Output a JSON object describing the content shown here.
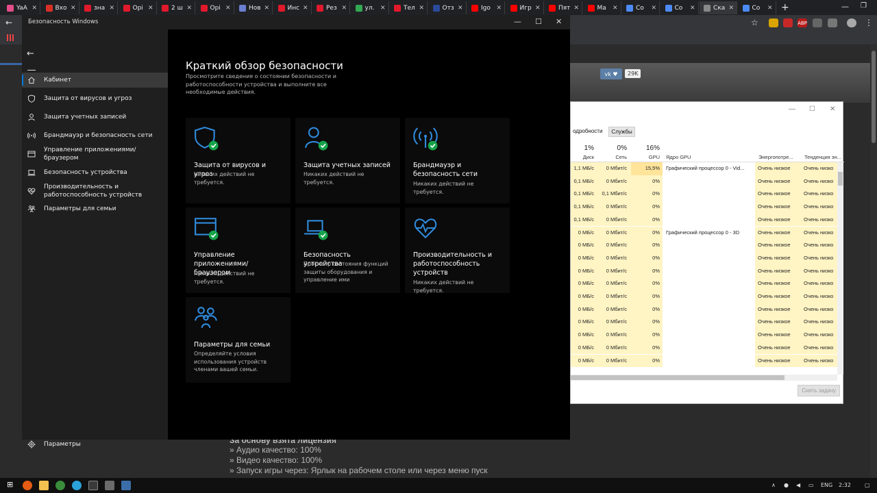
{
  "browser": {
    "tabs": [
      {
        "label": "YaA",
        "color": "#e44c8a"
      },
      {
        "label": "Вхо",
        "color": "#d93025"
      },
      {
        "label": "зна",
        "color": "#e0192b"
      },
      {
        "label": "Орі",
        "color": "#e0192b"
      },
      {
        "label": "2 ш",
        "color": "#e0192b"
      },
      {
        "label": "Орі",
        "color": "#e0192b"
      },
      {
        "label": "Нов",
        "color": "#6a7fd0"
      },
      {
        "label": "Инс",
        "color": "#e0192b"
      },
      {
        "label": "Рез",
        "color": "#e0192b"
      },
      {
        "label": "ул.",
        "color": "#34a853"
      },
      {
        "label": "Тел",
        "color": "#e0192b"
      },
      {
        "label": "Отз",
        "color": "#2b4a9a"
      },
      {
        "label": "Igo",
        "color": "#ff0000"
      },
      {
        "label": "Игр",
        "color": "#ff0000"
      },
      {
        "label": "Пят",
        "color": "#ff0000"
      },
      {
        "label": "Ма",
        "color": "#ff0000"
      },
      {
        "label": "Со",
        "color": "#4c8bf5"
      },
      {
        "label": "Со",
        "color": "#4c8bf5"
      },
      {
        "label": "Ска",
        "color": "#888888"
      },
      {
        "label": "Со",
        "color": "#4c8bf5"
      }
    ],
    "bg_page": {
      "vk_count": "29K",
      "lines": [
        "Аудио качество: 100%",
        "Видео качество: 100%",
        "Запуск игры через: Ярлык на рабочем столе или через меню пуск"
      ],
      "partial_top": "За основу взята лицензия"
    }
  },
  "task_manager": {
    "tabs": [
      "одробности",
      "Службы"
    ],
    "headers": {
      "disk_pct": "1%",
      "disk": "Диск",
      "net_pct": "0%",
      "net": "Сеть",
      "gpu_pct": "16%",
      "gpu": "GPU",
      "gpu_engine": "Ядро GPU",
      "power": "Энергопотре...",
      "power_trend": "Тенденция эн..."
    },
    "rows": [
      {
        "disk": "1,1 МБ/с",
        "net": "0 Мбит/с",
        "gpu": "15,5%",
        "engine": "Графический процессор 0 - Vid...",
        "power": "Очень низкое",
        "trend": "Очень низко"
      },
      {
        "disk": "0,1 МБ/с",
        "net": "0 Мбит/с",
        "gpu": "0%",
        "engine": "",
        "power": "Очень низкое",
        "trend": "Очень низко"
      },
      {
        "disk": "0,1 МБ/с",
        "net": "0,1 Мбит/с",
        "gpu": "0%",
        "engine": "",
        "power": "Очень низкое",
        "trend": "Очень низко"
      },
      {
        "disk": "0,1 МБ/с",
        "net": "0 Мбит/с",
        "gpu": "0%",
        "engine": "",
        "power": "Очень низкое",
        "trend": "Очень низко"
      },
      {
        "disk": "0,1 МБ/с",
        "net": "0 Мбит/с",
        "gpu": "0%",
        "engine": "",
        "power": "Очень низкое",
        "trend": "Очень низко"
      },
      {
        "disk": "0 МБ/с",
        "net": "0 Мбит/с",
        "gpu": "0%",
        "engine": "Графический процессор 0 - 3D",
        "power": "Очень низкое",
        "trend": "Очень низко"
      },
      {
        "disk": "0 МБ/с",
        "net": "0 Мбит/с",
        "gpu": "0%",
        "engine": "",
        "power": "Очень низкое",
        "trend": "Очень низко"
      },
      {
        "disk": "0 МБ/с",
        "net": "0 Мбит/с",
        "gpu": "0%",
        "engine": "",
        "power": "Очень низкое",
        "trend": "Очень низко"
      },
      {
        "disk": "0 МБ/с",
        "net": "0 Мбит/с",
        "gpu": "0%",
        "engine": "",
        "power": "Очень низкое",
        "trend": "Очень низко"
      },
      {
        "disk": "0 МБ/с",
        "net": "0 Мбит/с",
        "gpu": "0%",
        "engine": "",
        "power": "Очень низкое",
        "trend": "Очень низко"
      },
      {
        "disk": "0 МБ/с",
        "net": "0 Мбит/с",
        "gpu": "0%",
        "engine": "",
        "power": "Очень низкое",
        "trend": "Очень низко"
      },
      {
        "disk": "0 МБ/с",
        "net": "0 Мбит/с",
        "gpu": "0%",
        "engine": "",
        "power": "Очень низкое",
        "trend": "Очень низко"
      },
      {
        "disk": "0 МБ/с",
        "net": "0 Мбит/с",
        "gpu": "0%",
        "engine": "",
        "power": "Очень низкое",
        "trend": "Очень низко"
      },
      {
        "disk": "0 МБ/с",
        "net": "0 Мбит/с",
        "gpu": "0%",
        "engine": "",
        "power": "Очень низкое",
        "trend": "Очень низко"
      },
      {
        "disk": "0 МБ/с",
        "net": "0 Мбит/с",
        "gpu": "0%",
        "engine": "",
        "power": "Очень низкое",
        "trend": "Очень низко"
      },
      {
        "disk": "0 МБ/с",
        "net": "0 Мбит/с",
        "gpu": "0%",
        "engine": "",
        "power": "Очень низкое",
        "trend": "Очень низко"
      }
    ],
    "end_task": "Снять задачу"
  },
  "security": {
    "window_title": "Безопасность Windows",
    "nav": [
      {
        "label": "Кабинет",
        "icon": "home-icon",
        "active": true
      },
      {
        "label": "Защита от вирусов и угроз",
        "icon": "shield-icon"
      },
      {
        "label": "Защита учетных записей",
        "icon": "person-icon"
      },
      {
        "label": "Брандмауэр и безопасность сети",
        "icon": "wifi-icon"
      },
      {
        "label": "Управление приложениями/браузером",
        "icon": "app-window-icon"
      },
      {
        "label": "Безопасность устройства",
        "icon": "laptop-icon"
      },
      {
        "label": "Производительность и работоспособность устройств",
        "icon": "heart-icon"
      },
      {
        "label": "Параметры для семьи",
        "icon": "family-icon"
      }
    ],
    "settings_label": "Параметры",
    "heading": "Краткий обзор безопасности",
    "description": "Просмотрите сведения о состоянии безопасности и работоспособности устройства и выполните все необходимые действия.",
    "cards": [
      {
        "title": "Защита от вирусов и угроз",
        "subtitle": "Никаких действий не требуется.",
        "icon": "shield-check-icon"
      },
      {
        "title": "Защита учетных записей",
        "subtitle": "Никаких действий не требуется.",
        "icon": "person-check-icon"
      },
      {
        "title": "Брандмауэр и безопасность сети",
        "subtitle": "Никаких действий не требуется.",
        "icon": "wifi-check-icon"
      },
      {
        "title": "Управление приложениями/браузером",
        "subtitle": "Никаких действий не требуется.",
        "icon": "app-window-check-icon"
      },
      {
        "title": "Безопасность устройства",
        "subtitle": "Просмотр состояния функций защиты оборудования и управление ими",
        "icon": "laptop-check-icon"
      },
      {
        "title": "Производительность и работоспособность устройств",
        "subtitle": "Никаких действий не требуется.",
        "icon": "heart-pulse-icon"
      },
      {
        "title": "Параметры для семьи",
        "subtitle": "Определяйте условия использования устройств членами вашей семьи.",
        "icon": "family-icon"
      }
    ]
  },
  "taskbar": {
    "lang": "ENG",
    "time": "2:32"
  },
  "colors": {
    "accent": "#0078d7",
    "check": "#16a34a",
    "icon_blue": "#2f8bdc"
  }
}
